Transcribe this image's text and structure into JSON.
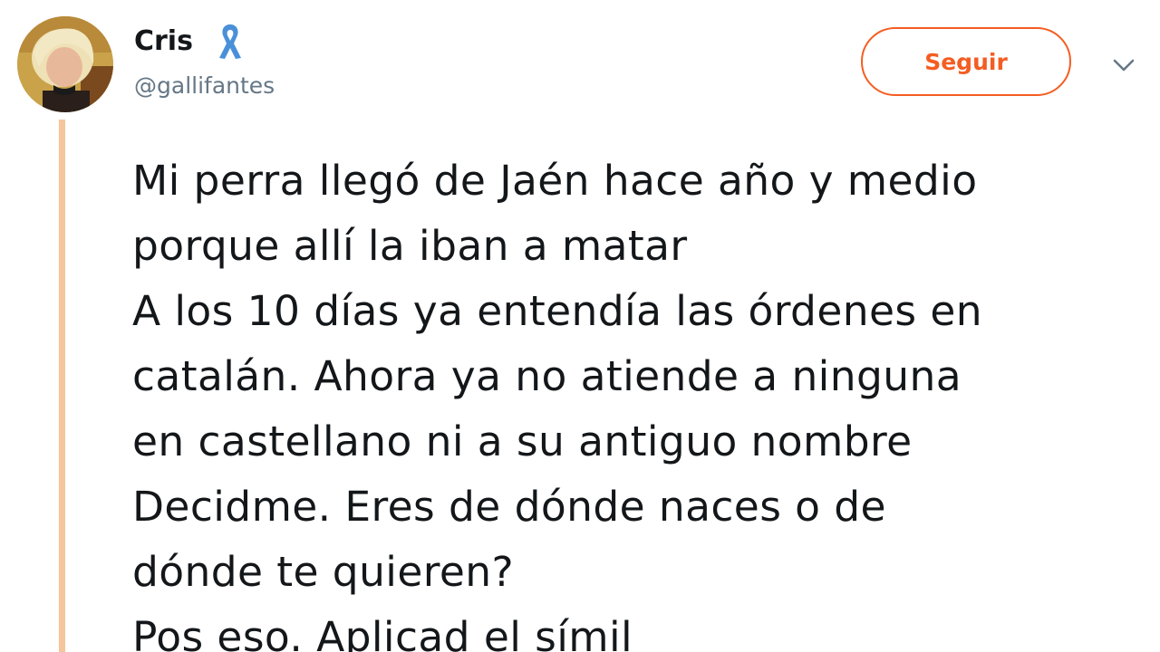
{
  "author": {
    "display_name": "Cris",
    "handle": "@gallifantes",
    "badge_icon": "ribbon-icon",
    "badge_color": "#4a90d9"
  },
  "actions": {
    "follow_label": "Seguir",
    "menu_icon": "chevron-down-icon",
    "accent_color": "#f45d22"
  },
  "tweet": {
    "lines": [
      "Mi perra llegó de Jaén hace año y medio",
      "porque allí la iban a matar",
      "A los 10 días ya entendía las órdenes en",
      "catalán. Ahora ya no atiende a ninguna",
      "en castellano ni a su antiguo nombre",
      "Decidme. Eres de dónde naces o de",
      "dónde te quieren?",
      "Pos eso. Aplicad el símil"
    ]
  }
}
